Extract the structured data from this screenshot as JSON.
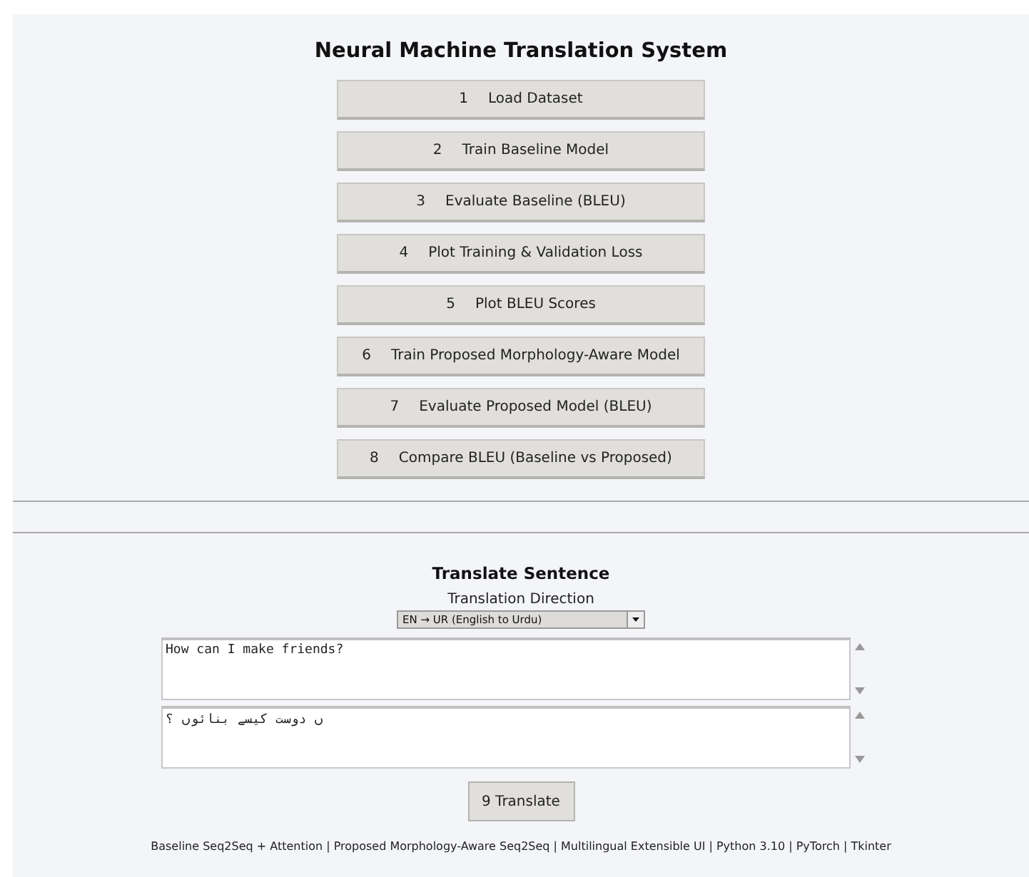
{
  "title": "Neural Machine Translation System",
  "actions": [
    {
      "number": "1",
      "label": "Load Dataset"
    },
    {
      "number": "2",
      "label": "Train Baseline Model"
    },
    {
      "number": "3",
      "label": "Evaluate Baseline (BLEU)"
    },
    {
      "number": "4",
      "label": "Plot Training & Validation Loss"
    },
    {
      "number": "5",
      "label": "Plot BLEU Scores"
    },
    {
      "number": "6",
      "label": "Train Proposed Morphology-Aware Model"
    },
    {
      "number": "7",
      "label": "Evaluate Proposed Model (BLEU)"
    },
    {
      "number": "8",
      "label": "Compare BLEU (Baseline vs Proposed)"
    }
  ],
  "translate": {
    "heading": "Translate Sentence",
    "direction_label": "Translation Direction",
    "direction_value": "EN → UR (English to Urdu)",
    "input": {
      "value": "How can I make friends?"
    },
    "output": {
      "value": "ں دوست کیسے بنائوں ؟"
    },
    "button": "9 Translate"
  },
  "footer": "Baseline Seq2Seq + Attention | Proposed Morphology-Aware Seq2Seq | Multilingual Extensible UI | Python 3.10 | PyTorch | Tkinter"
}
